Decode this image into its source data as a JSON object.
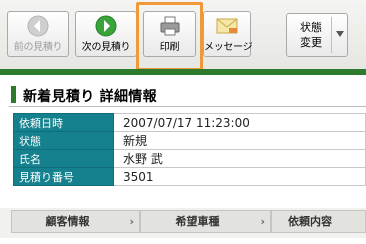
{
  "toolbar": {
    "prev_label": "前の見積り",
    "next_label": "次の見積り",
    "print_label": "印刷",
    "message_label": "メッセージ",
    "status_line1": "状態",
    "status_line2": "変更"
  },
  "page": {
    "title": "新着見積り 詳細情報"
  },
  "details": [
    {
      "key": "依頼日時",
      "value": "2007/07/17 11:23:00"
    },
    {
      "key": "状態",
      "value": "新規"
    },
    {
      "key": "氏名",
      "value": "水野 武"
    },
    {
      "key": "見積り番号",
      "value": "3501"
    }
  ],
  "tabs": [
    {
      "label": "顧客情報"
    },
    {
      "label": "希望車種"
    },
    {
      "label": "依頼内容"
    }
  ],
  "colors": {
    "accent_green": "#2d7a2d",
    "table_key_teal": "#15808e",
    "highlight_orange": "#f0983a"
  }
}
